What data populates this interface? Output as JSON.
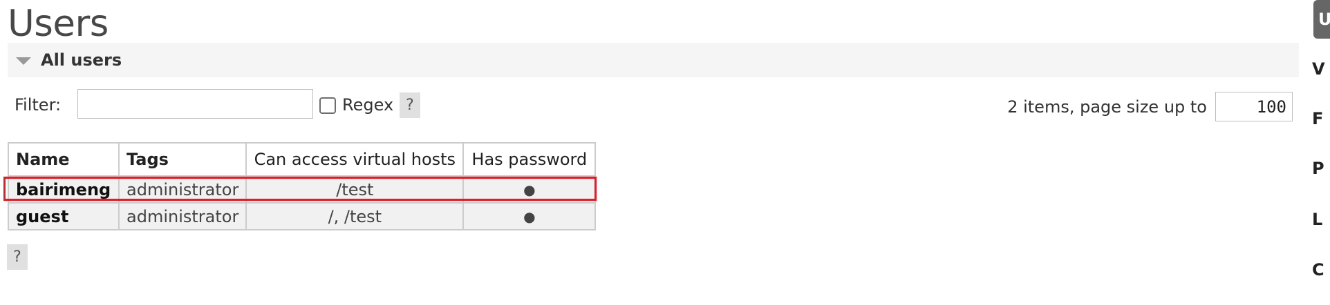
{
  "page": {
    "title": "Users"
  },
  "section": {
    "title": "All users"
  },
  "filter": {
    "label": "Filter:",
    "value": "",
    "regex_label": "Regex",
    "regex_checked": false,
    "help": "?"
  },
  "pagination": {
    "summary": "2 items, page size up to",
    "page_size": "100"
  },
  "table": {
    "headers": [
      "Name",
      "Tags",
      "Can access virtual hosts",
      "Has password"
    ],
    "rows": [
      {
        "name": "bairimeng",
        "tags": "administrator",
        "vhosts": "/test",
        "has_password": "●"
      },
      {
        "name": "guest",
        "tags": "administrator",
        "vhosts": "/, /test",
        "has_password": "●"
      }
    ]
  },
  "footer": {
    "help": "?"
  },
  "side_nav": {
    "items": [
      "U",
      "V",
      "F",
      "P",
      "L",
      "C"
    ]
  },
  "colors": {
    "highlight": "#d6202a",
    "active_tab": "#666666"
  }
}
